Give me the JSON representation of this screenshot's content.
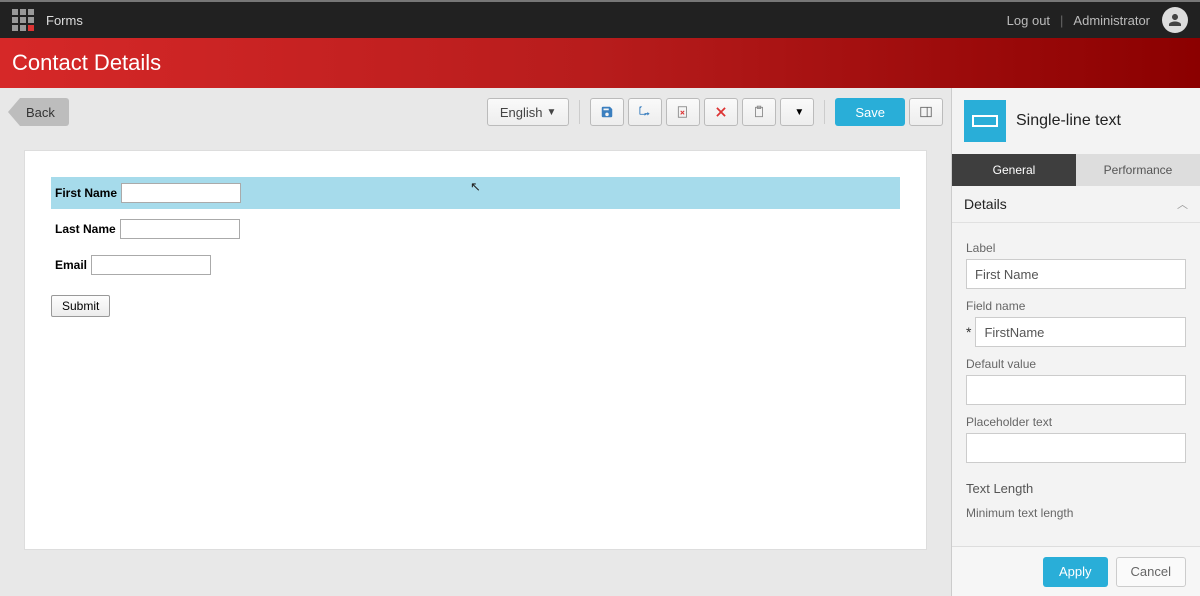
{
  "topbar": {
    "app_name": "Forms",
    "logout_label": "Log out",
    "user_label": "Administrator"
  },
  "header": {
    "page_title": "Contact Details"
  },
  "toolbar": {
    "back_label": "Back",
    "language_label": "English",
    "save_label": "Save"
  },
  "form": {
    "fields": [
      {
        "label": "First Name",
        "value": "",
        "selected": true
      },
      {
        "label": "Last Name",
        "value": "",
        "selected": false
      },
      {
        "label": "Email",
        "value": "",
        "selected": false
      }
    ],
    "submit_label": "Submit"
  },
  "inspector": {
    "type_title": "Single-line text",
    "tabs": {
      "general": "General",
      "performance": "Performance"
    },
    "section_details": "Details",
    "label_label": "Label",
    "label_value": "First Name",
    "fieldname_label": "Field name",
    "fieldname_value": "FirstName",
    "default_label": "Default value",
    "default_value": "",
    "placeholder_label": "Placeholder text",
    "placeholder_value": "",
    "textlength_title": "Text Length",
    "minlen_label": "Minimum text length",
    "apply_label": "Apply",
    "cancel_label": "Cancel"
  }
}
